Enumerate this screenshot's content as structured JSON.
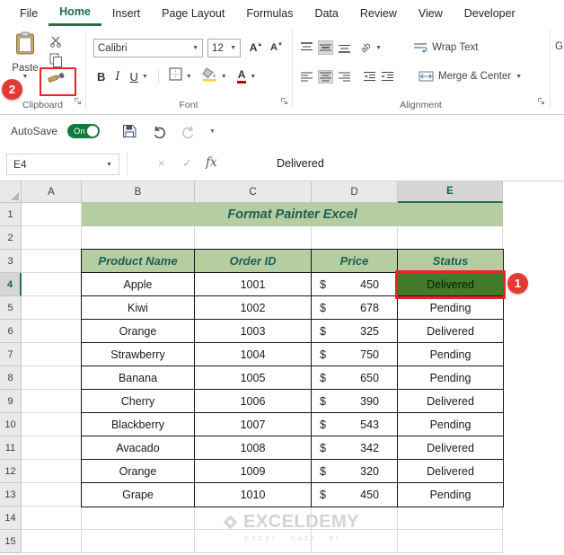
{
  "tabs": {
    "items": [
      "File",
      "Home",
      "Insert",
      "Page Layout",
      "Formulas",
      "Data",
      "Review",
      "View",
      "Developer"
    ],
    "active": "Home"
  },
  "ribbon": {
    "clipboard": {
      "group_label": "Clipboard",
      "paste": "Paste"
    },
    "font": {
      "group_label": "Font",
      "name": "Calibri",
      "size": "12",
      "bold": "B",
      "italic": "I",
      "underline": "U"
    },
    "alignment": {
      "group_label": "Alignment",
      "wrap_text": "Wrap Text",
      "merge_center": "Merge & Center",
      "orientation": "ab"
    },
    "number": {
      "partial": "G"
    }
  },
  "quick_access": {
    "autosave": "AutoSave",
    "toggle": "On"
  },
  "formula_bar": {
    "name_box": "E4",
    "cancel": "×",
    "enter": "✓",
    "fx": "fx",
    "value": "Delivered"
  },
  "sheet": {
    "col_headers": [
      "A",
      "B",
      "C",
      "D",
      "E"
    ],
    "row_headers": [
      "1",
      "2",
      "3",
      "4",
      "5",
      "6",
      "7",
      "8",
      "9",
      "10",
      "11",
      "12",
      "13",
      "14",
      "15"
    ],
    "title": "Format Painter Excel",
    "selected_cell": "E4",
    "table": {
      "headers": [
        "Product Name",
        "Order ID",
        "Price",
        "Status"
      ],
      "rows": [
        {
          "product": "Apple",
          "order": "1001",
          "cur": "$",
          "price": "450",
          "status": "Delivered"
        },
        {
          "product": "Kiwi",
          "order": "1002",
          "cur": "$",
          "price": "678",
          "status": "Pending"
        },
        {
          "product": "Orange",
          "order": "1003",
          "cur": "$",
          "price": "325",
          "status": "Delivered"
        },
        {
          "product": "Strawberry",
          "order": "1004",
          "cur": "$",
          "price": "750",
          "status": "Pending"
        },
        {
          "product": "Banana",
          "order": "1005",
          "cur": "$",
          "price": "650",
          "status": "Pending"
        },
        {
          "product": "Cherry",
          "order": "1006",
          "cur": "$",
          "price": "390",
          "status": "Delivered"
        },
        {
          "product": "Blackberry",
          "order": "1007",
          "cur": "$",
          "price": "543",
          "status": "Pending"
        },
        {
          "product": "Avacado",
          "order": "1008",
          "cur": "$",
          "price": "342",
          "status": "Delivered"
        },
        {
          "product": "Orange",
          "order": "1009",
          "cur": "$",
          "price": "320",
          "status": "Delivered"
        },
        {
          "product": "Grape",
          "order": "1010",
          "cur": "$",
          "price": "450",
          "status": "Pending"
        }
      ]
    }
  },
  "watermark": {
    "name": "EXCELDEMY",
    "tagline": "EXCEL · DATA · BI"
  },
  "annotations": {
    "step1": "1",
    "step2": "2"
  },
  "colors": {
    "accent_green": "#217346",
    "band_fill": "#b5cda1",
    "band_text": "#1d5f52",
    "selected_cell_fill": "#417a28",
    "annotation_red": "#e82525"
  }
}
